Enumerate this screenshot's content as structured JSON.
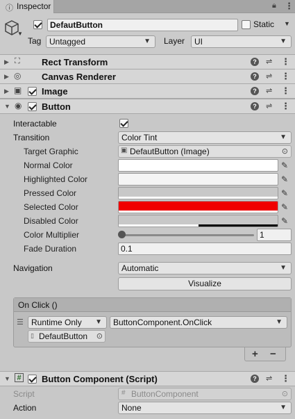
{
  "tab": {
    "label": "Inspector",
    "lock_icon": "lock-icon",
    "menu_icon": "kebab-icon"
  },
  "gameobject": {
    "name": "DefautButton",
    "active": true,
    "static_label": "Static",
    "static": false,
    "tag_label": "Tag",
    "tag_value": "Untagged",
    "layer_label": "Layer",
    "layer_value": "UI"
  },
  "components": {
    "rect_transform": {
      "title": "Rect Transform"
    },
    "canvas_renderer": {
      "title": "Canvas Renderer"
    },
    "image": {
      "title": "Image",
      "enabled": true
    },
    "button": {
      "title": "Button",
      "enabled": true
    },
    "script": {
      "title": "Button Component (Script)",
      "enabled": true
    }
  },
  "button_props": {
    "interactable_label": "Interactable",
    "interactable": true,
    "transition_label": "Transition",
    "transition_value": "Color Tint",
    "target_graphic_label": "Target Graphic",
    "target_graphic_value": "DefautButton (Image)",
    "normal_color_label": "Normal Color",
    "highlighted_color_label": "Highlighted Color",
    "pressed_color_label": "Pressed Color",
    "selected_color_label": "Selected Color",
    "disabled_color_label": "Disabled Color",
    "color_multiplier_label": "Color Multiplier",
    "color_multiplier_value": "1",
    "color_multiplier_fraction": 0.0,
    "fade_duration_label": "Fade Duration",
    "fade_duration_value": "0.1",
    "navigation_label": "Navigation",
    "navigation_value": "Automatic",
    "visualize_label": "Visualize"
  },
  "colors": {
    "normal": "#ffffff",
    "highlighted": "#f5f5f5",
    "pressed": "#c8c8c8",
    "selected": "#f00000",
    "disabled": "#c8c8c8"
  },
  "onclick": {
    "title": "On Click ()",
    "runtime_value": "Runtime Only",
    "function_value": "ButtonComponent.OnClick",
    "object_value": "DefautButton",
    "add_label": "+",
    "remove_label": "−"
  },
  "script_props": {
    "script_label": "Script",
    "script_value": "ButtonComponent",
    "action_label": "Action",
    "action_value": "None"
  }
}
